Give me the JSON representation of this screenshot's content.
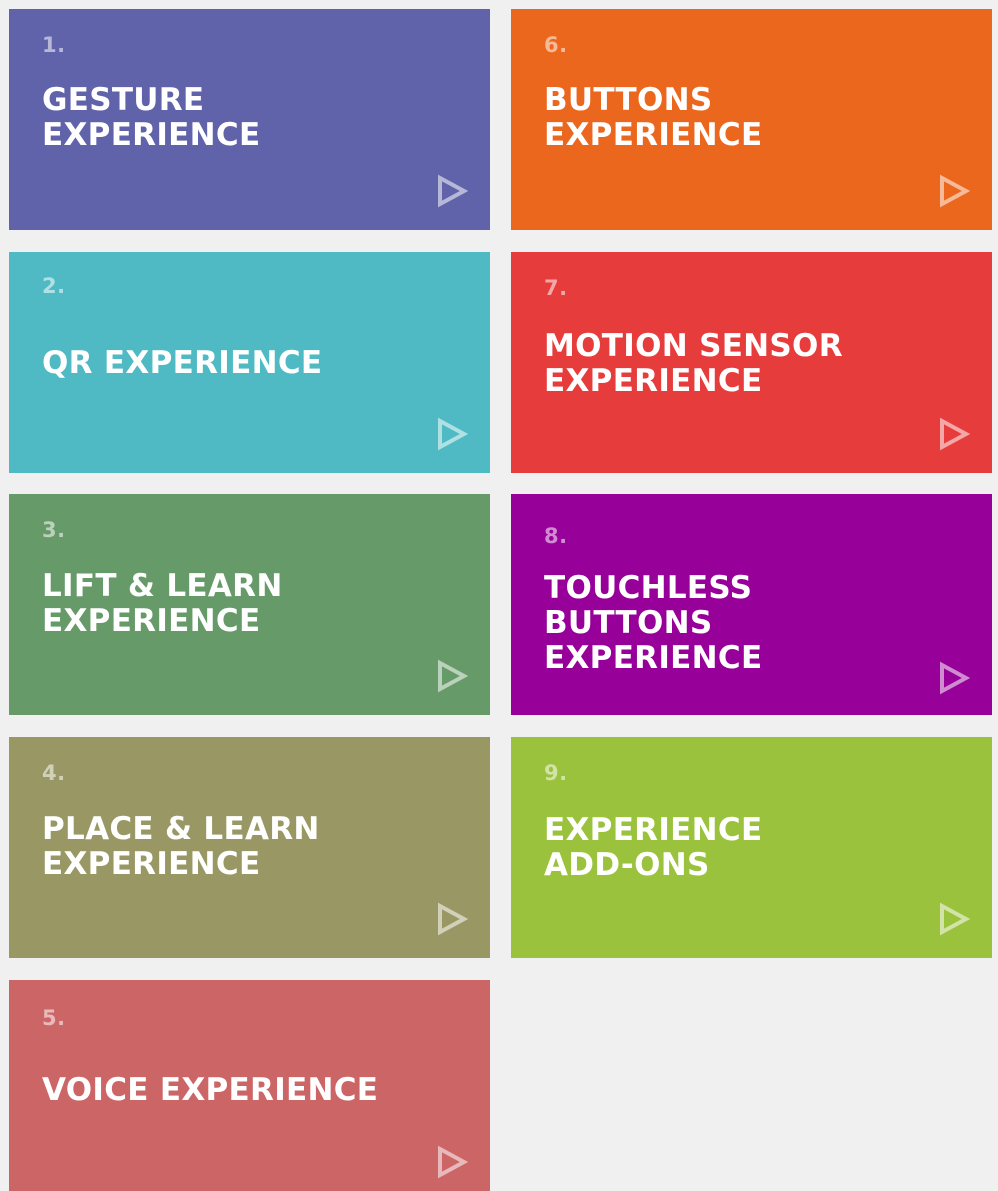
{
  "tiles": [
    {
      "number": "1.",
      "lines": [
        "GESTURE",
        "EXPERIENCE"
      ],
      "color": "#6063a9",
      "icon": "play-icon"
    },
    {
      "number": "2.",
      "lines": [
        "QR EXPERIENCE"
      ],
      "color": "#4fbac4",
      "icon": "play-icon"
    },
    {
      "number": "3.",
      "lines": [
        "LIFT & LEARN",
        "EXPERIENCE"
      ],
      "color": "#669a68",
      "icon": "play-icon"
    },
    {
      "number": "4.",
      "lines": [
        "PLACE & LEARN",
        "EXPERIENCE"
      ],
      "color": "#999865",
      "icon": "play-icon"
    },
    {
      "number": "5.",
      "lines": [
        "VOICE EXPERIENCE"
      ],
      "color": "#cc6566",
      "icon": "play-icon"
    },
    {
      "number": "6.",
      "lines": [
        "BUTTONS",
        "EXPERIENCE"
      ],
      "color": "#ec671e",
      "icon": "play-icon"
    },
    {
      "number": "7.",
      "lines": [
        "MOTION SENSOR",
        "EXPERIENCE"
      ],
      "color": "#e73c3c",
      "icon": "play-icon"
    },
    {
      "number": "8.",
      "lines": [
        "TOUCHLESS",
        "BUTTONS",
        "EXPERIENCE"
      ],
      "color": "#970099",
      "icon": "play-icon"
    },
    {
      "number": "9.",
      "lines": [
        "EXPERIENCE",
        "ADD-ONS"
      ],
      "color": "#9ac23c",
      "icon": "play-icon"
    }
  ]
}
